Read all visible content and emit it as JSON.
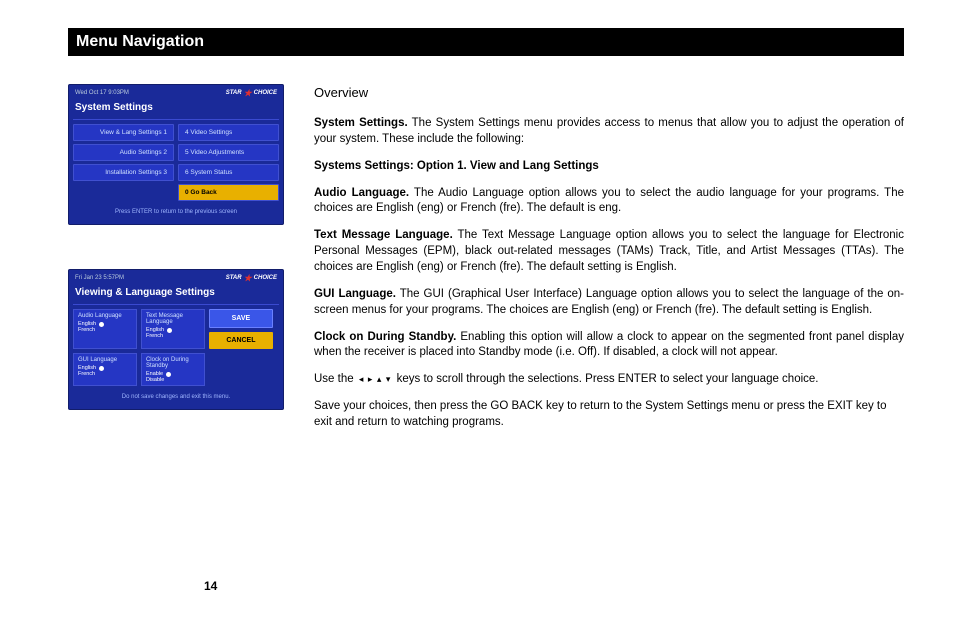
{
  "header": "Menu Navigation",
  "page_number": "14",
  "overview_heading": "Overview",
  "shot1": {
    "date": "Wed Oct 17 9:03PM",
    "logo_a": "STAR",
    "logo_b": "CHOICE",
    "title": "System Settings",
    "left": [
      "View & Lang Settings 1",
      "Audio Settings 2",
      "Installation Settings 3"
    ],
    "right": [
      "4 Video Settings",
      "5 Video Adjustments",
      "6 System Status"
    ],
    "goback": "0 Go Back",
    "footer": "Press ENTER to return to the previous screen"
  },
  "shot2": {
    "date": "Fri Jan 23 5:57PM",
    "logo_a": "STAR",
    "logo_b": "CHOICE",
    "title": "Viewing & Language Settings",
    "cells": {
      "audio": {
        "label": "Audio Language",
        "o1": "English",
        "o2": "French"
      },
      "text": {
        "label": "Text Message Language",
        "o1": "English",
        "o2": "French"
      },
      "gui": {
        "label": "GUI Language",
        "o1": "English",
        "o2": "French"
      },
      "clock": {
        "label": "Clock on During Standby",
        "o1": "Enable",
        "o2": "Disable"
      }
    },
    "save": "SAVE",
    "cancel": "CANCEL",
    "footer": "Do not save changes and exit this menu."
  },
  "body": {
    "p1_b": "System Settings.",
    "p1": " The System Settings menu provides access to menus that allow you to adjust the operation of your system. These include the following:",
    "p2_b": "Systems Settings: Option 1. View and Lang Settings",
    "p3_b": "Audio Language.",
    "p3": " The Audio Language option allows you to select the audio language for your programs. The choices are English (eng) or French (fre). The default is eng.",
    "p4_b": "Text Message Language.",
    "p4": " The Text Message Language option allows you to select the language for Electronic Personal Messages (EPM), black out-related messages (TAMs) Track, Title, and Artist Messages (TTAs). The choices are English (eng) or French (fre). The default setting is English.",
    "p5_b": "GUI Language.",
    "p5": " The GUI (Graphical User Interface) Language option allows you to select the language of the on-screen menus for your programs. The choices are English (eng) or French (fre). The default setting is English.",
    "p6_b": "Clock on During Standby.",
    "p6": " Enabling this option will allow a clock to appear on the segmented front panel display when the receiver is placed into Standby mode (i.e. Off). If disabled, a clock will not appear.",
    "p7a": "Use the",
    "p7b": " keys to scroll through the selections. Press ENTER to select your language choice.",
    "p8": "Save your choices, then press the GO BACK key to return to the System Settings menu or press the EXIT key to exit and return to watching programs."
  }
}
